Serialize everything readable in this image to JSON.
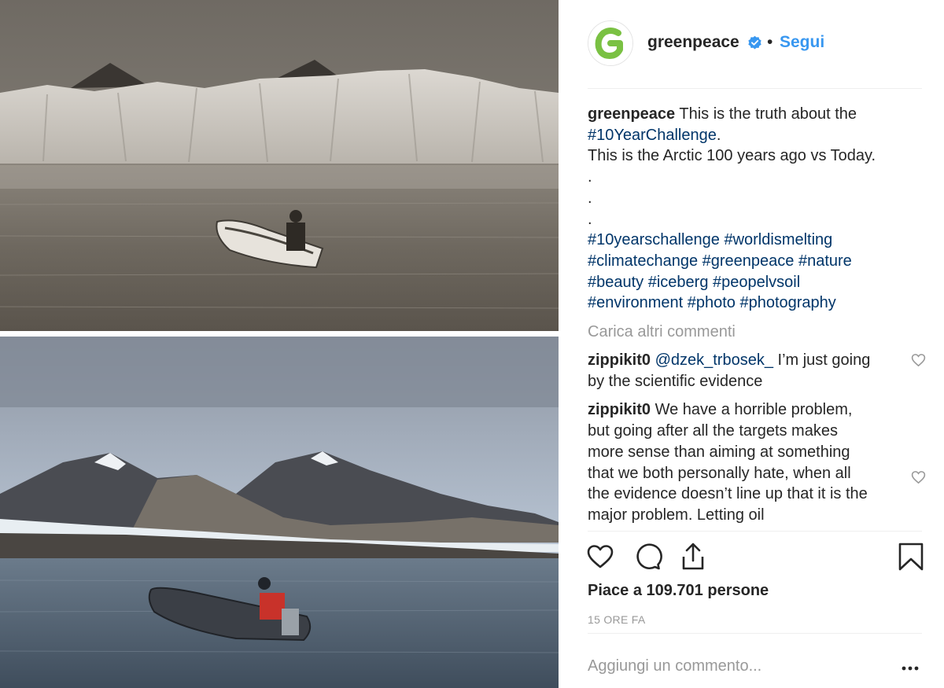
{
  "post": {
    "username": "greenpeace",
    "separator": "•",
    "follow_label": "Segui",
    "brand_color": "#7ac143",
    "link_color": "#003569",
    "follow_color": "#3897f0",
    "avatar_icon": "greenpeace-g-logo",
    "verified_icon": "verified-badge-icon"
  },
  "caption": {
    "username": "greenpeace",
    "text_1": " This is the truth about the ",
    "tag_1": "#10YearChallenge",
    "text_1_end": ".",
    "text_2": "This is the Arctic 100 years ago vs Today.",
    "dots": [
      ".",
      ".",
      "."
    ],
    "hashtags_lines": [
      "#10yearschallenge #worldismelting",
      "#climatechange #greenpeace #nature",
      "#beauty #iceberg #peopelvsoil",
      "#environment #photo #photography"
    ]
  },
  "load_more_label": "Carica altri commenti",
  "comments": [
    {
      "username": "zippikit0",
      "mention": "@dzek_trbosek_",
      "text": " I’m just going by the scientific evidence"
    },
    {
      "username": "zippikit0",
      "mention": "",
      "text": " We have a horrible problem, but going after all the targets makes more sense than aiming at something that we both personally hate, when all the evidence doesn’t line up that it is the major problem. Letting oil"
    }
  ],
  "actions": {
    "like_icon": "heart-icon",
    "comment_icon": "comment-bubble-icon",
    "share_icon": "share-icon",
    "save_icon": "bookmark-icon"
  },
  "likes_label": "Piace a 109.701 persone",
  "timestamp": "15 ORE FA",
  "add_comment_placeholder": "Aggiungi un commento...",
  "more_options_icon": "ellipsis-icon"
}
